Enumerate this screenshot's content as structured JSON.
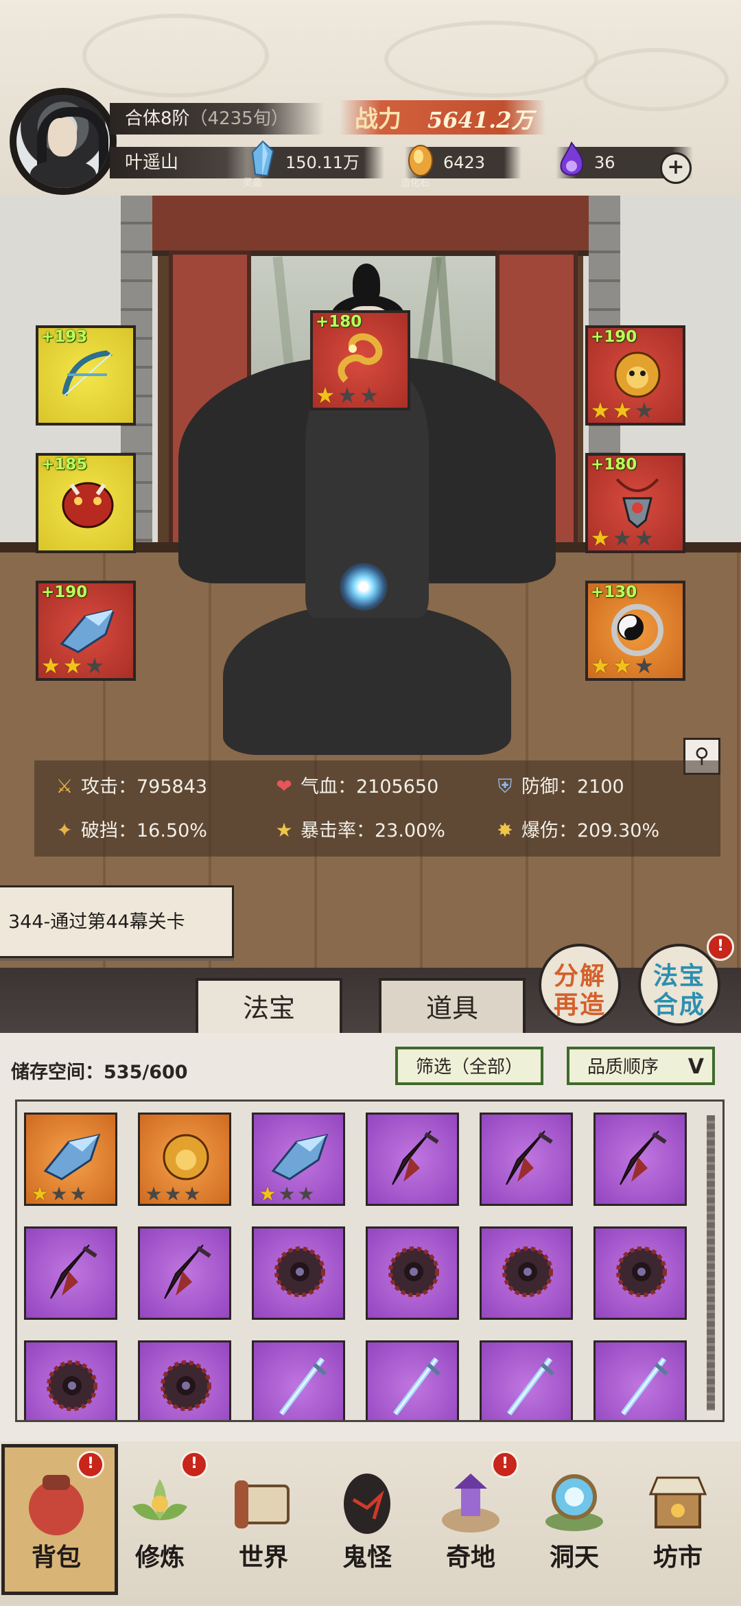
{
  "header": {
    "realm": "合体8阶",
    "realm_sub": "（4235旬）",
    "player_name": "叶遥山",
    "power_label": "战力",
    "power_value": "5641.2万",
    "resources": [
      {
        "icon": "spirit-crystal-icon",
        "value": "150.11万",
        "caption": "灵晶"
      },
      {
        "icon": "creation-stone-icon",
        "value": "6423",
        "caption": "造化石"
      },
      {
        "icon": "soul-flame-icon",
        "value": "36"
      }
    ],
    "plus_label": "+"
  },
  "equipment": [
    {
      "slot": "left-1",
      "bonus": "+193",
      "stars": 0,
      "quality": "yellow",
      "icon": "bow-icon"
    },
    {
      "slot": "left-2",
      "bonus": "+185",
      "stars": 0,
      "quality": "yellow",
      "icon": "demon-armor-icon"
    },
    {
      "slot": "left-3",
      "bonus": "+190",
      "stars": 2,
      "quality": "red",
      "icon": "crystal-bracer-icon"
    },
    {
      "slot": "top-center",
      "bonus": "+180",
      "stars": 1,
      "quality": "red",
      "icon": "golden-dragon-icon"
    },
    {
      "slot": "right-1",
      "bonus": "+190",
      "stars": 2,
      "quality": "red",
      "icon": "lion-beast-icon"
    },
    {
      "slot": "right-2",
      "bonus": "+180",
      "stars": 1,
      "quality": "red",
      "icon": "amulet-icon"
    },
    {
      "slot": "right-3",
      "bonus": "+130",
      "stars": 2,
      "quality": "orange",
      "icon": "yinyang-ring-icon"
    }
  ],
  "stats": [
    {
      "icon": "sword-icon",
      "label": "攻击：795843"
    },
    {
      "icon": "heart-icon",
      "label": "气血：2105650"
    },
    {
      "icon": "shield-icon",
      "label": "防御：2100"
    },
    {
      "icon": "break-icon",
      "label": "破挡：16.50%"
    },
    {
      "icon": "crit-icon",
      "label": "暴击率：23.00%"
    },
    {
      "icon": "crit-damage-icon",
      "label": "爆伤：209.30%"
    }
  ],
  "quest": "344-通过第44幕关卡",
  "buttons": {
    "decompose": [
      "分解",
      "再造"
    ],
    "synthesize": [
      "法宝",
      "合成"
    ],
    "badge": "!"
  },
  "tabs": [
    "法宝",
    "道具"
  ],
  "inventory": {
    "storage": "储存空间：535/600",
    "filter": "筛选（全部）",
    "sort": "品质顺序",
    "items": [
      {
        "quality": "orange",
        "stars": 1,
        "icon": "crystal-bracer-icon"
      },
      {
        "quality": "orange",
        "stars": 0,
        "icon": "lion-beast-icon"
      },
      {
        "quality": "purple",
        "stars": 1,
        "icon": "crystal-bracer-icon"
      },
      {
        "quality": "purple",
        "stars": null,
        "icon": "dark-blade-icon"
      },
      {
        "quality": "purple",
        "stars": null,
        "icon": "dark-blade-icon"
      },
      {
        "quality": "purple",
        "stars": null,
        "icon": "dark-blade-icon"
      },
      {
        "quality": "purple",
        "stars": null,
        "icon": "dark-blade-icon"
      },
      {
        "quality": "purple",
        "stars": null,
        "icon": "dark-blade-icon"
      },
      {
        "quality": "purple",
        "stars": null,
        "icon": "spiked-wheel-icon"
      },
      {
        "quality": "purple",
        "stars": null,
        "icon": "spiked-wheel-icon"
      },
      {
        "quality": "purple",
        "stars": null,
        "icon": "spiked-wheel-icon"
      },
      {
        "quality": "purple",
        "stars": null,
        "icon": "spiked-wheel-icon"
      },
      {
        "quality": "purple",
        "stars": null,
        "icon": "spiked-wheel-icon"
      },
      {
        "quality": "purple",
        "stars": null,
        "icon": "spiked-wheel-icon"
      },
      {
        "quality": "purple",
        "stars": null,
        "icon": "ice-sword-icon"
      },
      {
        "quality": "purple",
        "stars": null,
        "icon": "ice-sword-icon"
      },
      {
        "quality": "purple",
        "stars": null,
        "icon": "ice-sword-icon"
      },
      {
        "quality": "purple",
        "stars": null,
        "icon": "ice-sword-icon"
      }
    ]
  },
  "nav": [
    {
      "label": "背包",
      "icon": "bag-icon",
      "badge": true,
      "active": true
    },
    {
      "label": "修炼",
      "icon": "lotus-icon",
      "badge": true
    },
    {
      "label": "世界",
      "icon": "scroll-icon",
      "badge": false
    },
    {
      "label": "鬼怪",
      "icon": "demon-egg-icon",
      "badge": false
    },
    {
      "label": "奇地",
      "icon": "pagoda-icon",
      "badge": true
    },
    {
      "label": "洞天",
      "icon": "portal-icon",
      "badge": false
    },
    {
      "label": "坊市",
      "icon": "market-icon",
      "badge": false
    }
  ],
  "colors": {
    "accent_power": "#d1603d",
    "bonus_green": "#b8ff5a",
    "quality_yellow": "#e8d63a",
    "quality_red": "#c43c33",
    "quality_orange": "#e2822e",
    "quality_purple": "#a95bd0",
    "badge_red": "#c8251b"
  }
}
